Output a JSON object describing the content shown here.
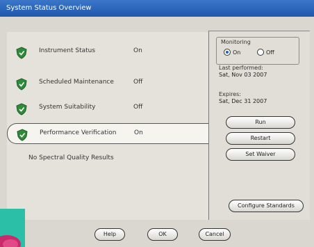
{
  "window": {
    "title": "System Status Overview"
  },
  "status_items": [
    {
      "label": "Instrument Status",
      "state": "On",
      "selected": false
    },
    {
      "label": "Scheduled Maintenance",
      "state": "Off",
      "selected": false
    },
    {
      "label": "System Suitability",
      "state": "Off",
      "selected": false
    },
    {
      "label": "Performance Verification",
      "state": "On",
      "selected": true
    }
  ],
  "results_text": "No Spectral Quality Results",
  "monitoring": {
    "title": "Monitoring",
    "on_label": "On",
    "off_label": "Off",
    "selected": "On"
  },
  "last_performed": {
    "label": "Last performed:",
    "value": "Sat, Nov 03 2007"
  },
  "expires": {
    "label": "Expires:",
    "value": "Sat, Dec 31 2007"
  },
  "side_buttons": {
    "run": "Run",
    "restart": "Restart",
    "set_waiver": "Set Waiver",
    "configure_standards": "Configure Standards"
  },
  "footer_buttons": {
    "help": "Help",
    "ok": "OK",
    "cancel": "Cancel"
  },
  "colors": {
    "titlebar": "#2a63b8",
    "shield_green": "#2e8b3a",
    "radio_selected": "#1f5ec8"
  }
}
